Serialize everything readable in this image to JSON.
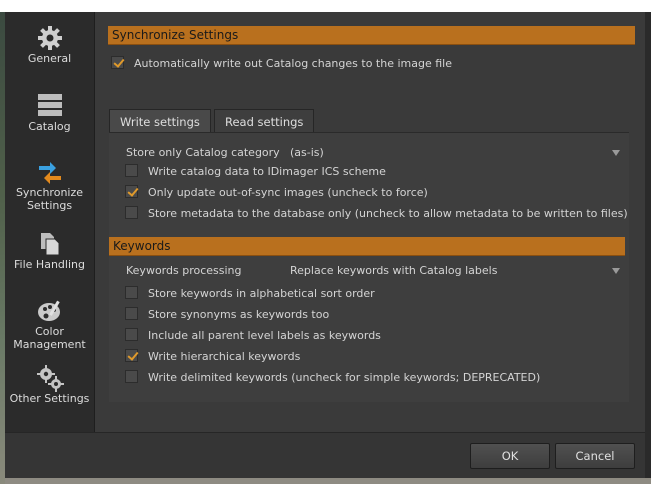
{
  "sidebar": {
    "items": [
      {
        "label": "General",
        "icon": "gear-icon"
      },
      {
        "label": "Catalog",
        "icon": "catalog-stack-icon"
      },
      {
        "label": "Synchronize Settings",
        "icon": "sync-arrows-icon"
      },
      {
        "label": "File Handling",
        "icon": "file-copy-icon"
      },
      {
        "label": "Color Management",
        "icon": "palette-icon"
      },
      {
        "label": "Other Settings",
        "icon": "gears-icon"
      }
    ]
  },
  "sync_section": {
    "title": "Synchronize Settings",
    "auto_write_label": "Automatically write out Catalog changes to the image file",
    "auto_write_checked": true
  },
  "tabs": [
    {
      "label": "Write settings",
      "active": true
    },
    {
      "label": "Read settings",
      "active": false
    }
  ],
  "write_settings": {
    "store_label": "Store only Catalog category",
    "store_value": "(as-is)",
    "options": [
      {
        "label": "Write catalog data to IDimager ICS scheme",
        "checked": false
      },
      {
        "label": "Only update out-of-sync images (uncheck to force)",
        "checked": true
      },
      {
        "label": "Store metadata to the database only (uncheck to allow metadata to be written to files)",
        "checked": false
      }
    ]
  },
  "keywords": {
    "title": "Keywords",
    "processing_label": "Keywords processing",
    "processing_value": "Replace keywords with Catalog labels",
    "options": [
      {
        "label": "Store keywords in alphabetical sort order",
        "checked": false
      },
      {
        "label": "Store synonyms as keywords too",
        "checked": false
      },
      {
        "label": "Include all parent level labels as keywords",
        "checked": false
      },
      {
        "label": "Write hierarchical keywords",
        "checked": true
      },
      {
        "label": "Write delimited keywords (uncheck for simple keywords; DEPRECATED)",
        "checked": false
      }
    ]
  },
  "footer": {
    "ok_label": "OK",
    "cancel_label": "Cancel"
  },
  "colors": {
    "accent": "#b9701e",
    "check": "#e09a2b"
  }
}
